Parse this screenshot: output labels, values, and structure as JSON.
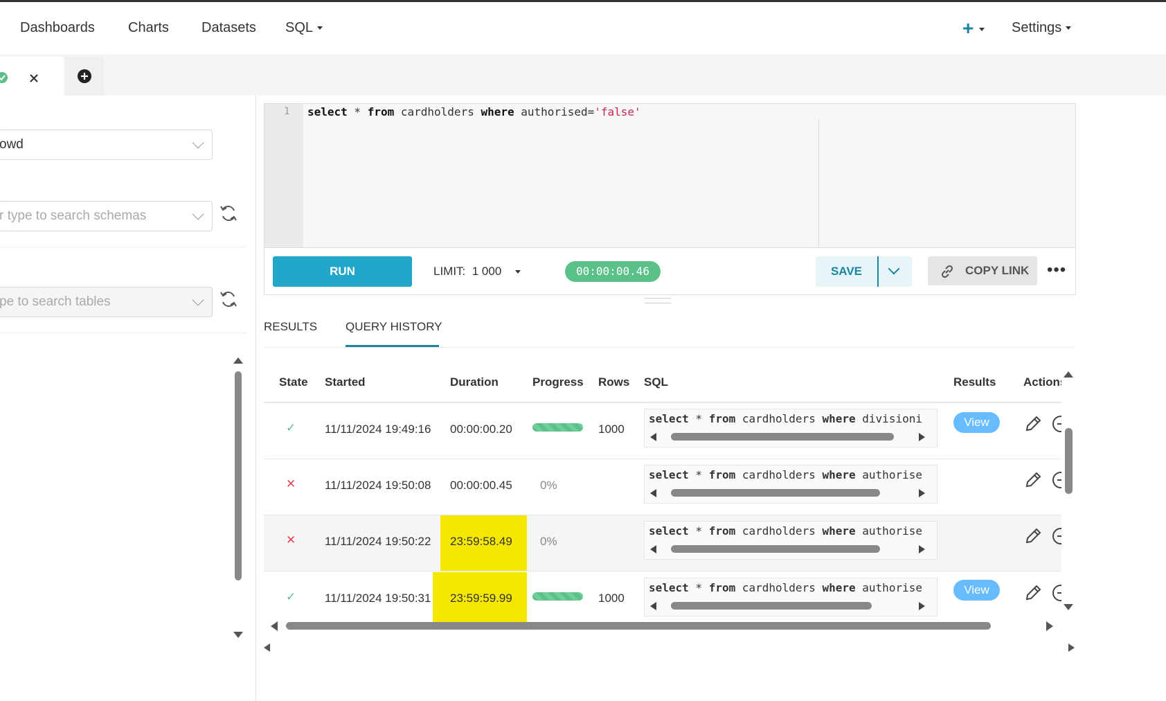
{
  "nav": {
    "dashboards": "Dashboards",
    "charts": "Charts",
    "datasets": "Datasets",
    "sql": "SQL",
    "settings": "Settings"
  },
  "left": {
    "database_value": "owd",
    "schema_placeholder": "r type to search schemas",
    "table_placeholder": "pe to search tables"
  },
  "editor": {
    "line_number": "1",
    "code": {
      "kw1": "select",
      "t1": " * ",
      "kw2": "from",
      "t2": " cardholders ",
      "kw3": "where",
      "t3": " authorised=",
      "str": "'false'"
    }
  },
  "toolbar": {
    "run_label": "RUN",
    "limit_label": "LIMIT:",
    "limit_value": "1 000",
    "timer": "00:00:00.46",
    "save_label": "SAVE",
    "copy_link_label": "COPY LINK"
  },
  "result_tabs": {
    "results": "RESULTS",
    "query_history": "QUERY HISTORY",
    "active": "query_history"
  },
  "history": {
    "columns": [
      "State",
      "Started",
      "Duration",
      "Progress",
      "Rows",
      "SQL",
      "Results",
      "Actions"
    ],
    "rows": [
      {
        "state": "success",
        "state_glyph": "✓",
        "started": "11/11/2024 19:49:16",
        "duration": "00:00:00.20",
        "progress_text": "",
        "progress": 1.0,
        "rows": "1000",
        "sql_field": "divisioni",
        "results": "View"
      },
      {
        "state": "failed",
        "state_glyph": "✕",
        "started": "11/11/2024 19:50:08",
        "duration": "00:00:00.45",
        "progress_text": "0%",
        "progress": 0,
        "rows": "",
        "sql_field": "authorise",
        "results": ""
      },
      {
        "state": "failed",
        "state_glyph": "✕",
        "started": "11/11/2024 19:50:22",
        "duration": "23:59:58.49",
        "progress_text": "0%",
        "progress": 0,
        "rows": "",
        "sql_field": "authorise",
        "results": ""
      },
      {
        "state": "success",
        "state_glyph": "✓",
        "started": "11/11/2024 19:50:31",
        "duration": "23:59:59.99",
        "progress_text": "",
        "progress": 1.0,
        "rows": "1000",
        "sql_field": "authorise",
        "results": "View"
      }
    ],
    "sql_prefix": {
      "kw1": "select",
      "t1": " * ",
      "kw2": "from",
      "t2": " cardholders ",
      "kw3": "where",
      "t3": " "
    }
  },
  "colors": {
    "accent": "#20a7c9",
    "success": "#5ac189",
    "error": "#e04355",
    "highlight": "#f5e800",
    "view_pill": "#66bcfe"
  }
}
